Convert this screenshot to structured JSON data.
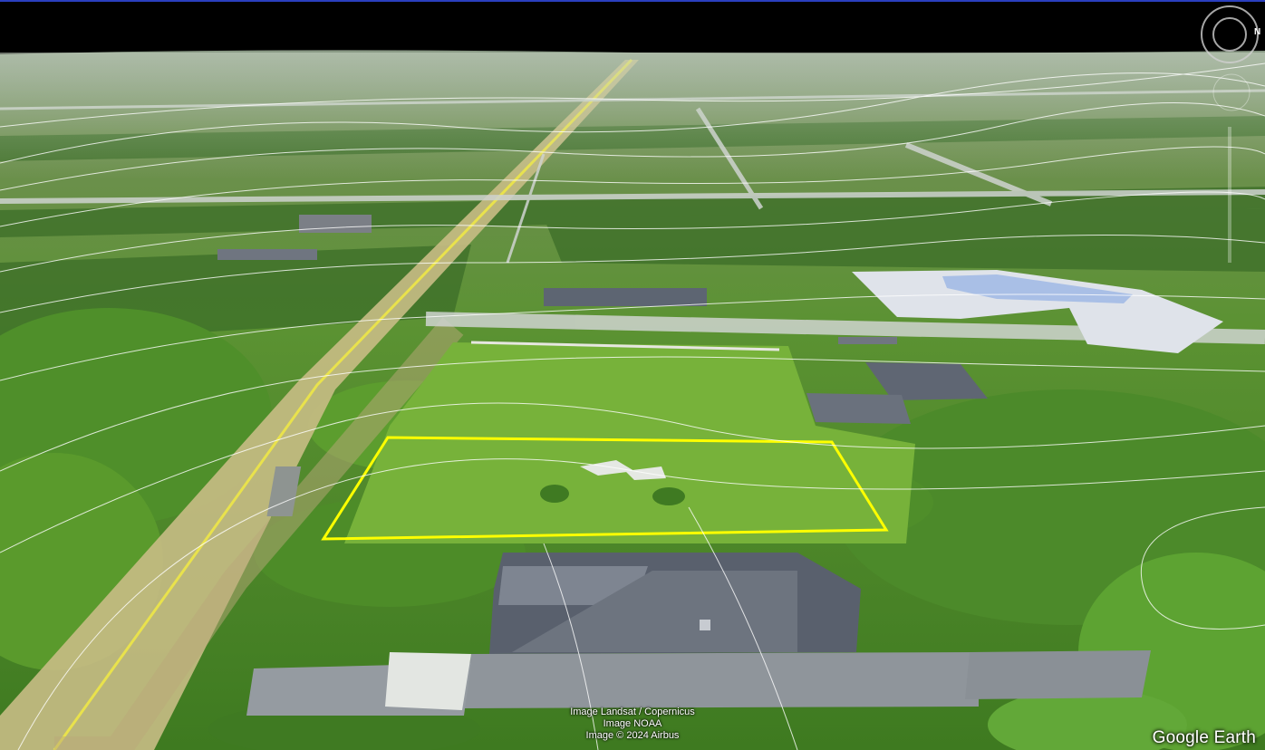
{
  "attribution": {
    "line1": "Image Landsat / Copernicus",
    "line2": "Image NOAA",
    "line3": "Image © 2024 Airbus"
  },
  "brand": "Google Earth",
  "compass": {
    "north_label": "N",
    "icon": "compass-icon"
  },
  "controls": {
    "tilt_icon": "tilt-icon",
    "zoom_icon": "zoom-slider"
  },
  "colors": {
    "sky": "#000000",
    "grass": "#7fb53c",
    "trees": "#3f7a26",
    "road": "#c6b980",
    "road_line": "#e8e04a",
    "contour": "#ffffff",
    "parcel_outline": "#ffff00",
    "roof": "#5c6370",
    "paved": "#9aa0a6",
    "pool": "#d9dee8"
  }
}
